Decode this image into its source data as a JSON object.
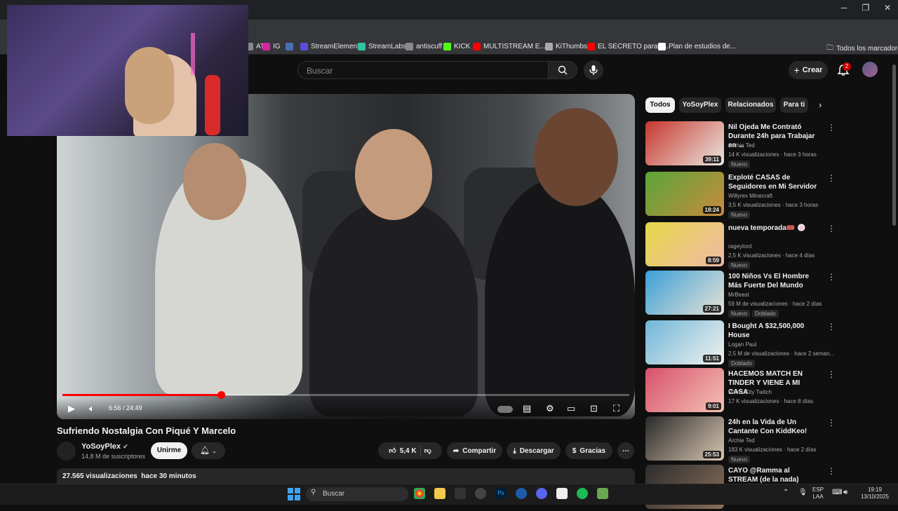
{
  "bookmarks": [
    {
      "label": "ATI",
      "color": "#888"
    },
    {
      "label": "IG",
      "color": "#d6249f"
    },
    {
      "label": "",
      "color": "#4a6fb5"
    },
    {
      "label": "StreamElements",
      "color": "#5b4bdb"
    },
    {
      "label": "StreamLabs",
      "color": "#31c3a2"
    },
    {
      "label": "antiscuff",
      "color": "#8a8a8a"
    },
    {
      "label": "KICK",
      "color": "#53fc18"
    },
    {
      "label": "MULTISTREAM E...",
      "color": "#ff0000"
    },
    {
      "label": "KiThumbs",
      "color": "#aaa"
    },
    {
      "label": "EL SECRETO para C...",
      "color": "#ff0000"
    },
    {
      "label": "Plan de estudios de...",
      "color": "#fff"
    }
  ],
  "bookmarks_all": "Todos los marcadores",
  "header": {
    "search_placeholder": "Buscar",
    "create_label": "Crear",
    "notif_count": "2"
  },
  "player": {
    "time": "6:56 / 24:49",
    "progress": 0.28
  },
  "video": {
    "title": "Sufriendo Nostalgia Con Piqué Y Marcelo",
    "channel": "YoSoyPlex",
    "subscribers": "14,8 M de suscriptores",
    "join_label": "Unirme",
    "likes": "5,4 K",
    "share_label": "Compartir",
    "download_label": "Descargar",
    "thanks_label": "Gracias",
    "views": "27.565 visualizaciones",
    "age": "hace 30 minutos"
  },
  "chips": [
    "Todos",
    "YoSoyPlex",
    "Relacionados",
    "Para ti"
  ],
  "recommendations": [
    {
      "title": "Nil Ojeda Me Contrató Durante 24h para Trabajar en ...",
      "channel": "Archie Ted",
      "meta": "14 K visualizaciones · hace 3 horas",
      "tags": [
        "Nuevo"
      ],
      "duration": "39:11",
      "c1": "#c8362d",
      "c2": "#e9e6df"
    },
    {
      "title": "Exploté CASAS de Seguidores en Mi Servidor",
      "channel": "Willyrex Minecraft",
      "meta": "3,5 K visualizaciones · hace 3 horas",
      "tags": [
        "Nuevo"
      ],
      "duration": "18:24",
      "c1": "#5aa63a",
      "c2": "#c98a3d"
    },
    {
      "title": "nueva temporada🎟️ 🍥",
      "channel": "rageylord",
      "meta": "2,5 K visualizaciones · hace 4 días",
      "tags": [
        "Nuevo"
      ],
      "duration": "8:59",
      "c1": "#e6d84a",
      "c2": "#f0b9a5"
    },
    {
      "title": "100 Niños Vs El Hombre Más Fuerte Del Mundo",
      "channel": "MrBeast",
      "meta": "59 M de visualizaciones · hace 2 días",
      "tags": [
        "Nuevo",
        "Doblado"
      ],
      "duration": "27:21",
      "c1": "#3aa0d8",
      "c2": "#e9e2d4"
    },
    {
      "title": "I Bought A $32,500,000 House",
      "channel": "Logan Paul",
      "meta": "2,5 M de visualizaciones · hace 2 seman...",
      "tags": [
        "Doblado"
      ],
      "duration": "11:51",
      "c1": "#6fb6d9",
      "c2": "#f2f2ee"
    },
    {
      "title": "HACEMOS MATCH EN TINDER Y VIENE A MI CASA",
      "channel": "Rama City Twitch",
      "meta": "17 K visualizaciones · hace 8 días",
      "tags": [],
      "duration": "9:01",
      "c1": "#d8506a",
      "c2": "#f3c2b6"
    },
    {
      "title": "24h en la Vida de Un Cantante Con KiddKeo!",
      "channel": "Archie Ted",
      "meta": "183 K visualizaciones · hace 2 días",
      "tags": [
        "Nuevo"
      ],
      "duration": "25:53",
      "c1": "#2a2a2a",
      "c2": "#d8c6b0"
    },
    {
      "title": "CAYO @Ramma al STREAM (de la nada)",
      "channel": "",
      "meta": "",
      "tags": [],
      "duration": "",
      "c1": "#2c2c2c",
      "c2": "#8b6f5a"
    }
  ],
  "taskbar": {
    "search_label": "Buscar",
    "lang": "ESP",
    "layout": "LAA",
    "time": "19:19",
    "date": "13/10/2025"
  }
}
